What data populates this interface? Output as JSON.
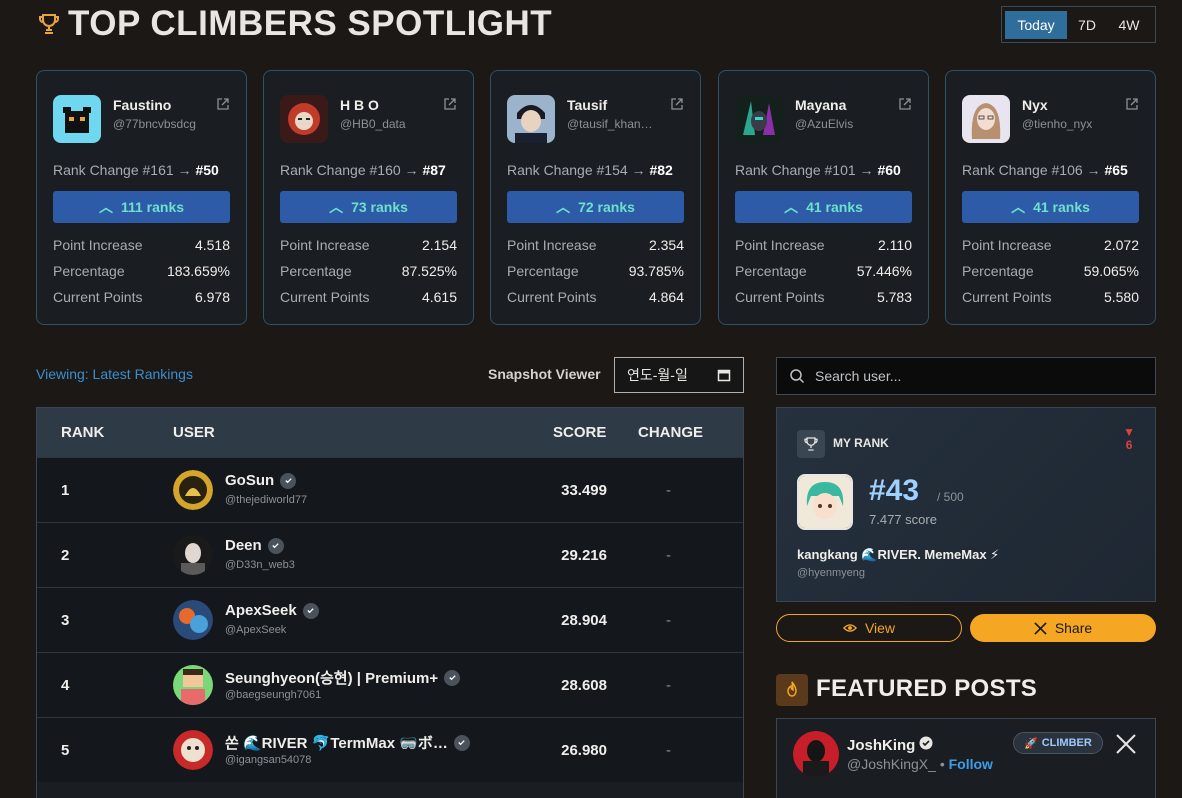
{
  "header": {
    "title": "TOP CLIMBERS SPOTLIGHT",
    "ranges": [
      "Today",
      "7D",
      "4W"
    ],
    "active_range": "Today"
  },
  "climbers": [
    {
      "name": "Faustino",
      "handle": "@77bncvbsdcg",
      "rank_from": "Rank Change #161 →",
      "rank_to": "#50",
      "ranks": "111 ranks",
      "point_increase": "4.518",
      "percentage": "183.659%",
      "current_points": "6.978"
    },
    {
      "name": "H B O",
      "handle": "@HB0_data",
      "rank_from": "Rank Change #160 →",
      "rank_to": "#87",
      "ranks": "73 ranks",
      "point_increase": "2.154",
      "percentage": "87.525%",
      "current_points": "4.615"
    },
    {
      "name": "Tausif",
      "handle": "@tausif_khan…",
      "rank_from": "Rank Change #154 →",
      "rank_to": "#82",
      "ranks": "72 ranks",
      "point_increase": "2.354",
      "percentage": "93.785%",
      "current_points": "4.864"
    },
    {
      "name": "Mayana",
      "handle": "@AzuElvis",
      "rank_from": "Rank Change #101 →",
      "rank_to": "#60",
      "ranks": "41 ranks",
      "point_increase": "2.110",
      "percentage": "57.446%",
      "current_points": "5.783"
    },
    {
      "name": "Nyx",
      "handle": "@tienho_nyx",
      "rank_from": "Rank Change #106 →",
      "rank_to": "#65",
      "ranks": "41 ranks",
      "point_increase": "2.072",
      "percentage": "59.065%",
      "current_points": "5.580"
    }
  ],
  "stat_labels": {
    "point_increase": "Point Increase",
    "percentage": "Percentage",
    "current_points": "Current Points"
  },
  "viewing": "Viewing: Latest Rankings",
  "snapshot": {
    "label": "Snapshot Viewer",
    "date_placeholder": "연도-월-일"
  },
  "search": {
    "placeholder": "Search user..."
  },
  "table": {
    "columns": [
      "RANK",
      "USER",
      "SCORE",
      "CHANGE"
    ],
    "rows": [
      {
        "rank": "1",
        "name": "GoSun",
        "handle": "@thejediworld77",
        "score": "33.499",
        "change": "-"
      },
      {
        "rank": "2",
        "name": "Deen",
        "handle": "@D33n_web3",
        "score": "29.216",
        "change": "-"
      },
      {
        "rank": "3",
        "name": "ApexSeek",
        "handle": "@ApexSeek",
        "score": "28.904",
        "change": "-"
      },
      {
        "rank": "4",
        "name": "Seunghyeon(승현) | Premium+",
        "handle": "@baegseungh7061",
        "score": "28.608",
        "change": "-"
      },
      {
        "rank": "5",
        "name": "쏜 🌊RIVER 🐬TermMax 🥽ボ…",
        "handle": "@igangsan54078",
        "score": "26.980",
        "change": "-"
      }
    ]
  },
  "my_rank": {
    "label": "MY RANK",
    "change": "6",
    "rank": "#43",
    "total": "/ 500",
    "score": "7.477 score",
    "name": "kangkang 🌊RIVER. MemeMax ⚡",
    "handle": "@hyenmyeng"
  },
  "actions": {
    "view": "View",
    "share": "Share"
  },
  "featured": {
    "title": "FEATURED POSTS",
    "post": {
      "name": "JoshKing",
      "handle": "@JoshKingX_ •",
      "follow": "Follow",
      "badge": "CLIMBER"
    }
  },
  "colors": {
    "accent": "#f5a623",
    "rank_button": "#2d5ba8",
    "rank_button_text": "#6fe0c9",
    "link": "#3a8fd0",
    "down": "#e0403a"
  }
}
